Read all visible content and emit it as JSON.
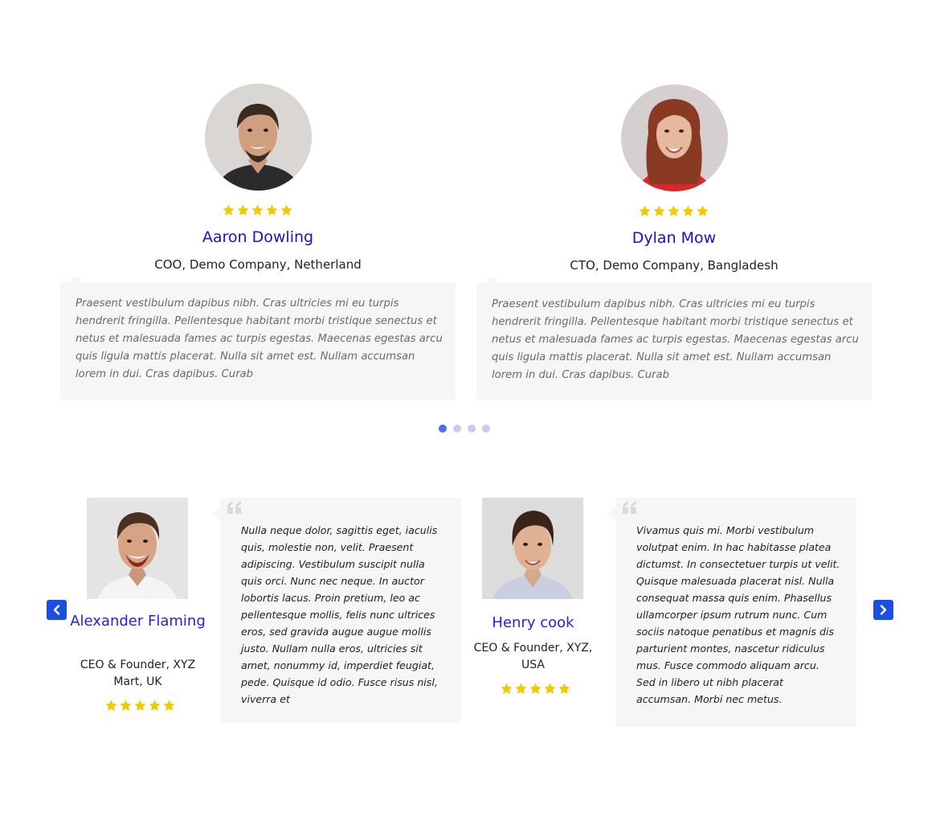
{
  "colors": {
    "star": "#f6c800",
    "name_primary": "#1a10c9",
    "name_secondary": "#2222d8",
    "quote_bg": "#f6f6f6",
    "dot_active": "#4a70e8",
    "dot_inactive": "#c5cdf2",
    "nav_button": "#1a4fe0"
  },
  "slider_top": {
    "testimonials": [
      {
        "name": "Aaron Dowling",
        "role": "COO, Demo Company, Netherland",
        "rating": 5,
        "quote": "Praesent vestibulum dapibus nibh. Cras ultricies mi eu turpis hendrerit fringilla. Pellentesque habitant morbi tristique senectus et netus et malesuada fames ac turpis egestas. Maecenas egestas arcu quis ligula mattis placerat. Nulla sit amet est. Nullam accumsan lorem in dui. Cras dapibus. Curab"
      },
      {
        "name": "Dylan Mow",
        "role": "CTO, Demo Company, Bangladesh",
        "rating": 5,
        "quote": "Praesent vestibulum dapibus nibh. Cras ultricies mi eu turpis hendrerit fringilla. Pellentesque habitant morbi tristique senectus et netus et malesuada fames ac turpis egestas. Maecenas egestas arcu quis ligula mattis placerat. Nulla sit amet est. Nullam accumsan lorem in dui. Cras dapibus. Curab"
      }
    ],
    "pagination": {
      "total": 4,
      "active": 1
    }
  },
  "slider_bottom": {
    "prev_icon": "chevron-left-icon",
    "next_icon": "chevron-right-icon",
    "testimonials": [
      {
        "name": "Alexander Flaming",
        "role": "CEO & Founder, XYZ Mart, UK",
        "rating": 5,
        "quote_icon": "quote-icon",
        "quote": "Nulla neque dolor, sagittis eget, iaculis quis, molestie non, velit. Praesent adipiscing. Vestibulum suscipit nulla quis orci. Nunc nec neque. In auctor lobortis lacus. Proin pretium, leo ac pellentesque mollis, felis nunc ultrices eros, sed gravida augue augue mollis justo. Nullam nulla eros, ultricies sit amet, nonummy id, imperdiet feugiat, pede. Quisque id odio. Fusce risus nisl, viverra et"
      },
      {
        "name": "Henry cook",
        "role": "CEO & Founder, XYZ, USA",
        "rating": 5,
        "quote_icon": "quote-icon",
        "quote": "Vivamus quis mi. Morbi vestibulum volutpat enim. In hac habitasse platea dictumst. In consectetuer turpis ut velit. Quisque malesuada placerat nisl. Nulla consequat massa quis enim. Phasellus ullamcorper ipsum rutrum nunc. Cum sociis natoque penatibus et magnis dis parturient montes, nascetur ridiculus mus. Fusce commodo aliquam arcu. Sed in libero ut nibh placerat accumsan. Morbi nec metus."
      }
    ]
  }
}
